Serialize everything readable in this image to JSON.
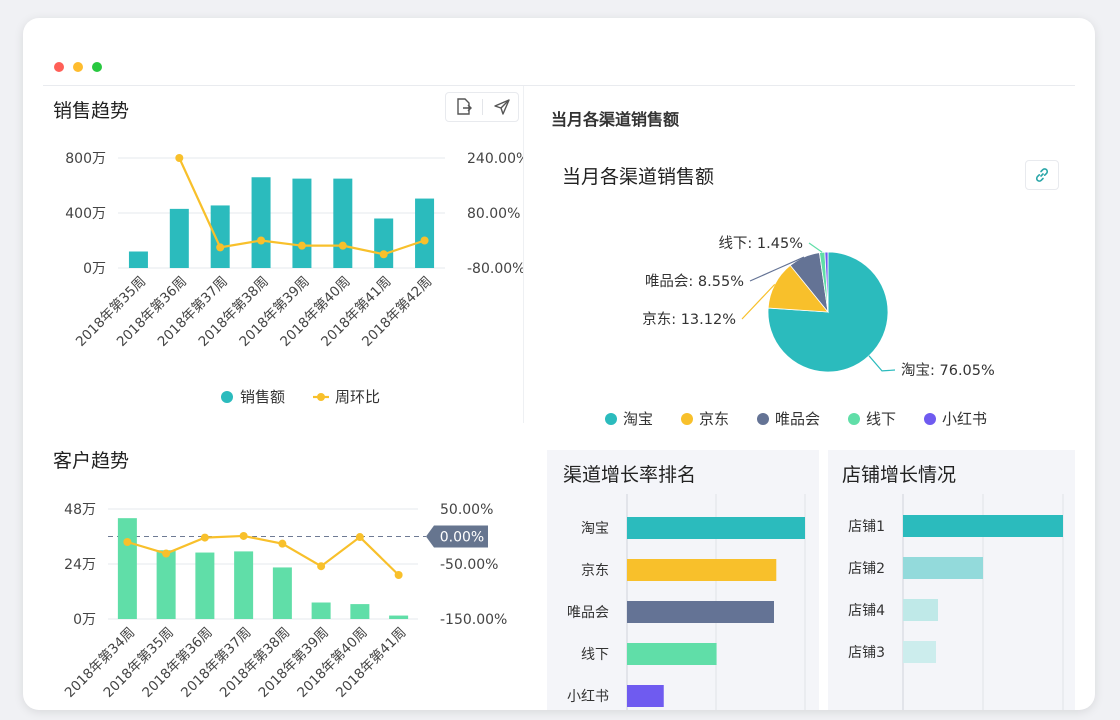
{
  "colors": {
    "teal": "#2bbbbd",
    "yellow": "#f8c02b",
    "slate": "#647395",
    "green": "#60dea8",
    "purple": "#6f5bf0"
  },
  "window": {
    "controls": [
      "close",
      "minimize",
      "maximize"
    ],
    "control_colors": [
      "#ff5f57",
      "#febc2e",
      "#28c840"
    ]
  },
  "sales_panel": {
    "title": "销售趋势",
    "export_icon": "export-icon",
    "send_icon": "send-icon"
  },
  "customer_panel": {
    "title": "客户趋势"
  },
  "channel_section": {
    "title": "当月各渠道销售额",
    "link_icon": "link-icon"
  },
  "growth_panel": {
    "title": "渠道增长率排名"
  },
  "store_panel": {
    "title": "店铺增长情况"
  },
  "chart_data": [
    {
      "type": "bar",
      "title": "销售趋势",
      "categories": [
        "2018年第35周",
        "2018年第36周",
        "2018年第37周",
        "2018年第38周",
        "2018年第39周",
        "2018年第40周",
        "2018年第41周",
        "2018年第42周"
      ],
      "series": [
        {
          "name": "销售额",
          "type": "bar",
          "values": [
            120,
            430,
            455,
            660,
            650,
            650,
            360,
            505
          ]
        },
        {
          "name": "周环比",
          "type": "line",
          "axis": "right",
          "values": [
            "",
            240,
            -20,
            0,
            -15,
            -15,
            -40,
            0
          ]
        }
      ],
      "y_left": {
        "ticks": [
          "800万",
          "400万",
          "0万"
        ],
        "range": [
          0,
          800
        ]
      },
      "y_right": {
        "ticks": [
          "240.00%",
          "80.00%",
          "-80.00%"
        ],
        "range": [
          -80,
          240
        ]
      },
      "legend": "bottom"
    },
    {
      "type": "bar",
      "title": "客户趋势",
      "categories": [
        "2018年第34周",
        "2018年第35周",
        "2018年第36周",
        "2018年第37周",
        "2018年第38周",
        "2018年第39周",
        "2018年第40周",
        "2018年第41周"
      ],
      "series": [
        {
          "name": "",
          "type": "bar",
          "values": [
            44,
            30,
            29,
            29.5,
            22.5,
            7.2,
            6.5,
            1.5
          ]
        },
        {
          "name": "",
          "type": "line",
          "axis": "right",
          "values": [
            -10,
            -31,
            -2,
            1,
            -13,
            -54,
            -1,
            -70
          ]
        }
      ],
      "y_left": {
        "ticks": [
          "48万",
          "24万",
          "0万"
        ],
        "range": [
          0,
          48
        ]
      },
      "y_right": {
        "ticks": [
          "50.00%",
          "-50.00%",
          "-150.00%"
        ],
        "range": [
          -150,
          50
        ]
      },
      "reference_line": {
        "value_label": "0.00%",
        "value": 0
      }
    },
    {
      "type": "pie",
      "title": "当月各渠道销售额",
      "slices": [
        {
          "name": "淘宝",
          "value": 76.05,
          "label": "淘宝: 76.05%"
        },
        {
          "name": "京东",
          "value": 13.12,
          "label": "京东: 13.12%"
        },
        {
          "name": "唯品会",
          "value": 8.55,
          "label": "唯品会: 8.55%"
        },
        {
          "name": "线下",
          "value": 1.45,
          "label": "线下: 1.45%"
        },
        {
          "name": "小红书",
          "value": 0.83,
          "label": ""
        }
      ],
      "legend": "bottom"
    },
    {
      "type": "bar",
      "orientation": "horizontal",
      "title": "渠道增长率排名",
      "categories": [
        "淘宝",
        "京东",
        "唯品会",
        "线下",
        "小红书"
      ],
      "values": [
        155,
        130,
        128,
        78,
        32
      ]
    },
    {
      "type": "bar",
      "orientation": "horizontal",
      "title": "店铺增长情况",
      "categories": [
        "店铺1",
        "店铺2",
        "店铺4",
        "店铺3"
      ],
      "values": [
        160,
        80,
        35,
        33
      ]
    }
  ]
}
